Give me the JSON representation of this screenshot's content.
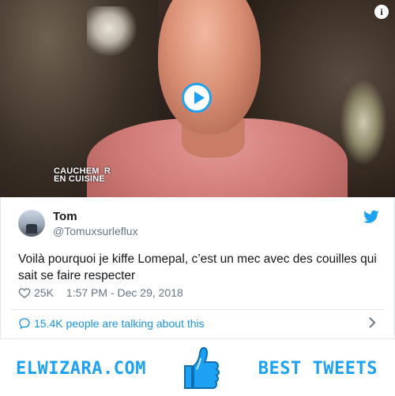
{
  "video": {
    "info_icon": "info-icon",
    "play_icon": "play-icon",
    "show_logo_line1": "CAUCHEM_R",
    "show_logo_line2": "EN CUISINE"
  },
  "tweet": {
    "author_name": "Tom",
    "author_handle": "@Tomuxsurleflux",
    "text": "Voilà pourquoi je kiffe Lomepal, c’est un mec avec des couilles qui sait se faire respecter",
    "likes": "25K",
    "timestamp": "1:57 PM - Dec 29, 2018",
    "talking": "15.4K people are talking about this",
    "colors": {
      "accent": "#1da1f2",
      "link": "#1b95e0",
      "muted": "#657786"
    }
  },
  "banner": {
    "left_text": "ELWIZARA.COM",
    "right_text": "BEST TWEETS",
    "icon": "thumbs-up-icon",
    "color": "#1da1f2"
  }
}
